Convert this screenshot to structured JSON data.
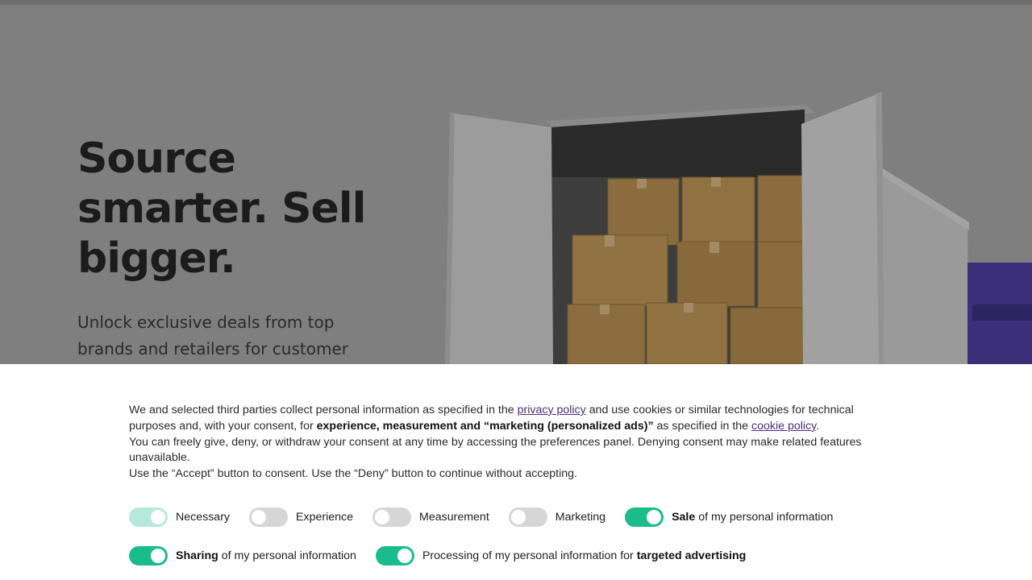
{
  "hero": {
    "title": "Source smarter. Sell bigger.",
    "subtitle": "Unlock exclusive deals from top brands and retailers for customer"
  },
  "consent": {
    "p1_a": "We and selected third parties collect personal information as specified in the ",
    "privacy_link": "privacy policy",
    "p1_b": " and use cookies or similar technologies for technical purposes and, with your consent, for ",
    "p1_bold": "experience, measurement and “marketing (personalized ads)”",
    "p1_c": " as specified in the ",
    "cookie_link": "cookie policy",
    "p1_d": ".",
    "p2": "You can freely give, deny, or withdraw your consent at any time by accessing the preferences panel. Denying consent may make related features unavailable.",
    "p3": "Use the “Accept” button to consent. Use the “Deny” button to continue without accepting."
  },
  "toggles": {
    "necessary": {
      "label": "Necessary",
      "state": "on-locked"
    },
    "experience": {
      "label": "Experience",
      "state": "off"
    },
    "measurement": {
      "label": "Measurement",
      "state": "off"
    },
    "marketing": {
      "label": "Marketing",
      "state": "off"
    },
    "sale": {
      "bold": "Sale",
      "rest": " of my personal information",
      "state": "on"
    },
    "sharing": {
      "bold": "Sharing",
      "rest": " of my personal information",
      "state": "on"
    },
    "targeted": {
      "pre": "Processing of my personal information for ",
      "bold": "targeted advertising",
      "state": "on"
    }
  },
  "colors": {
    "toggle_on": "#1bbc8b",
    "toggle_off": "#d6d6d6",
    "link": "#4b2e83"
  }
}
